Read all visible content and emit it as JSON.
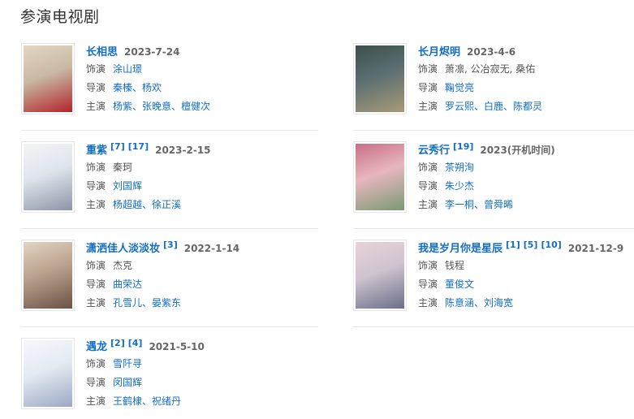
{
  "section_title": "参演电视剧",
  "labels": {
    "role": "饰演",
    "director": "导演",
    "starring": "主演"
  },
  "dramas": [
    {
      "title": "长相思",
      "refs": [],
      "date": "2023-7-24",
      "role": "涂山璟",
      "role_is_link": true,
      "director": "秦榛、杨欢",
      "starring": "杨紫、张晚意、檀健次",
      "poster_colors": [
        "#c8b9a3",
        "#b3242a",
        "#e5d6c2"
      ]
    },
    {
      "title": "长月烬明",
      "refs": [],
      "date": "2023-4-6",
      "role": "萧凛, 公冶寂无, 桑佑",
      "role_is_link": false,
      "director": "鞠觉亮",
      "starring": "罗云熙、白鹿、陈都灵",
      "poster_colors": [
        "#5b6e72",
        "#a89a78",
        "#3d4f4b"
      ]
    },
    {
      "title": "重紫",
      "refs": [
        "[7]",
        "[17]"
      ],
      "date": "2023-2-15",
      "role": "秦珂",
      "role_is_link": false,
      "director": "刘国辉",
      "starring": "杨超越、徐正溪",
      "poster_colors": [
        "#dfe4ec",
        "#8c94a7",
        "#f4f4f6"
      ]
    },
    {
      "title": "云秀行",
      "refs": [
        "[19]"
      ],
      "date": "2023(开机时间)",
      "role": "茶朔洵",
      "role_is_link": true,
      "director": "朱少杰",
      "starring": "李一桐、曾舜晞",
      "poster_colors": [
        "#e7b6bf",
        "#7a9a73",
        "#c96f86"
      ]
    },
    {
      "title": "潇洒佳人淡淡妆",
      "refs": [
        "[3]"
      ],
      "date": "2022-1-14",
      "role": "杰克",
      "role_is_link": false,
      "director": "曲荣达",
      "starring": "孔雪儿、晏紫东",
      "poster_colors": [
        "#b9a28c",
        "#6b5346",
        "#e3d4c4"
      ]
    },
    {
      "title": "我是岁月你是星辰",
      "refs": [
        "[1]",
        "[5]",
        "[10]"
      ],
      "date": "2021-12-9",
      "role": "钱程",
      "role_is_link": false,
      "director": "董俊文",
      "starring": "陈意涵、刘海宽",
      "poster_colors": [
        "#cfc3cf",
        "#6b6f89",
        "#e8d3d8"
      ]
    },
    {
      "title": "遇龙",
      "refs": [
        "[2]",
        "[4]"
      ],
      "date": "2021-5-10",
      "role": "雪阡寻",
      "role_is_link": true,
      "director": "闵国辉",
      "starring": "王鹤棣、祝绪丹",
      "poster_colors": [
        "#e4eaf2",
        "#9aa8c2",
        "#f6f7fa"
      ]
    }
  ]
}
